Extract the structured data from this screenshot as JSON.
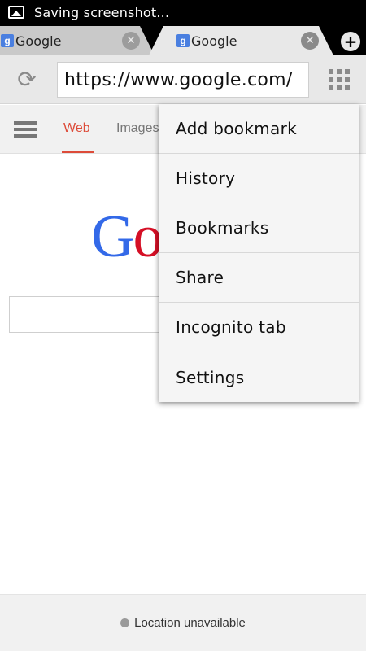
{
  "status_bar": {
    "notification_icon": "image-icon",
    "text": "Saving screenshot..."
  },
  "tabs": [
    {
      "favicon": "g",
      "title": "Google",
      "close_icon": "close-icon",
      "active": false
    },
    {
      "favicon": "g",
      "title": "Google",
      "close_icon": "close-icon",
      "active": true
    }
  ],
  "new_tab_icon": "plus-icon",
  "toolbar": {
    "reload_icon": "reload-icon",
    "url": "https://www.google.com/",
    "apps_icon": "grid-icon"
  },
  "google_nav": {
    "menu_icon": "hamburger-icon",
    "web_label": "Web",
    "images_label": "Images"
  },
  "logo": {
    "visible_text": [
      "G",
      "o"
    ]
  },
  "overflow_menu": {
    "items": [
      "Add bookmark",
      "History",
      "Bookmarks",
      "Share",
      "Incognito tab",
      "Settings"
    ]
  },
  "footer": {
    "location_text": "Location unavailable"
  },
  "colors": {
    "google_red": "#dd4b39",
    "google_blue": "#3369e8"
  }
}
